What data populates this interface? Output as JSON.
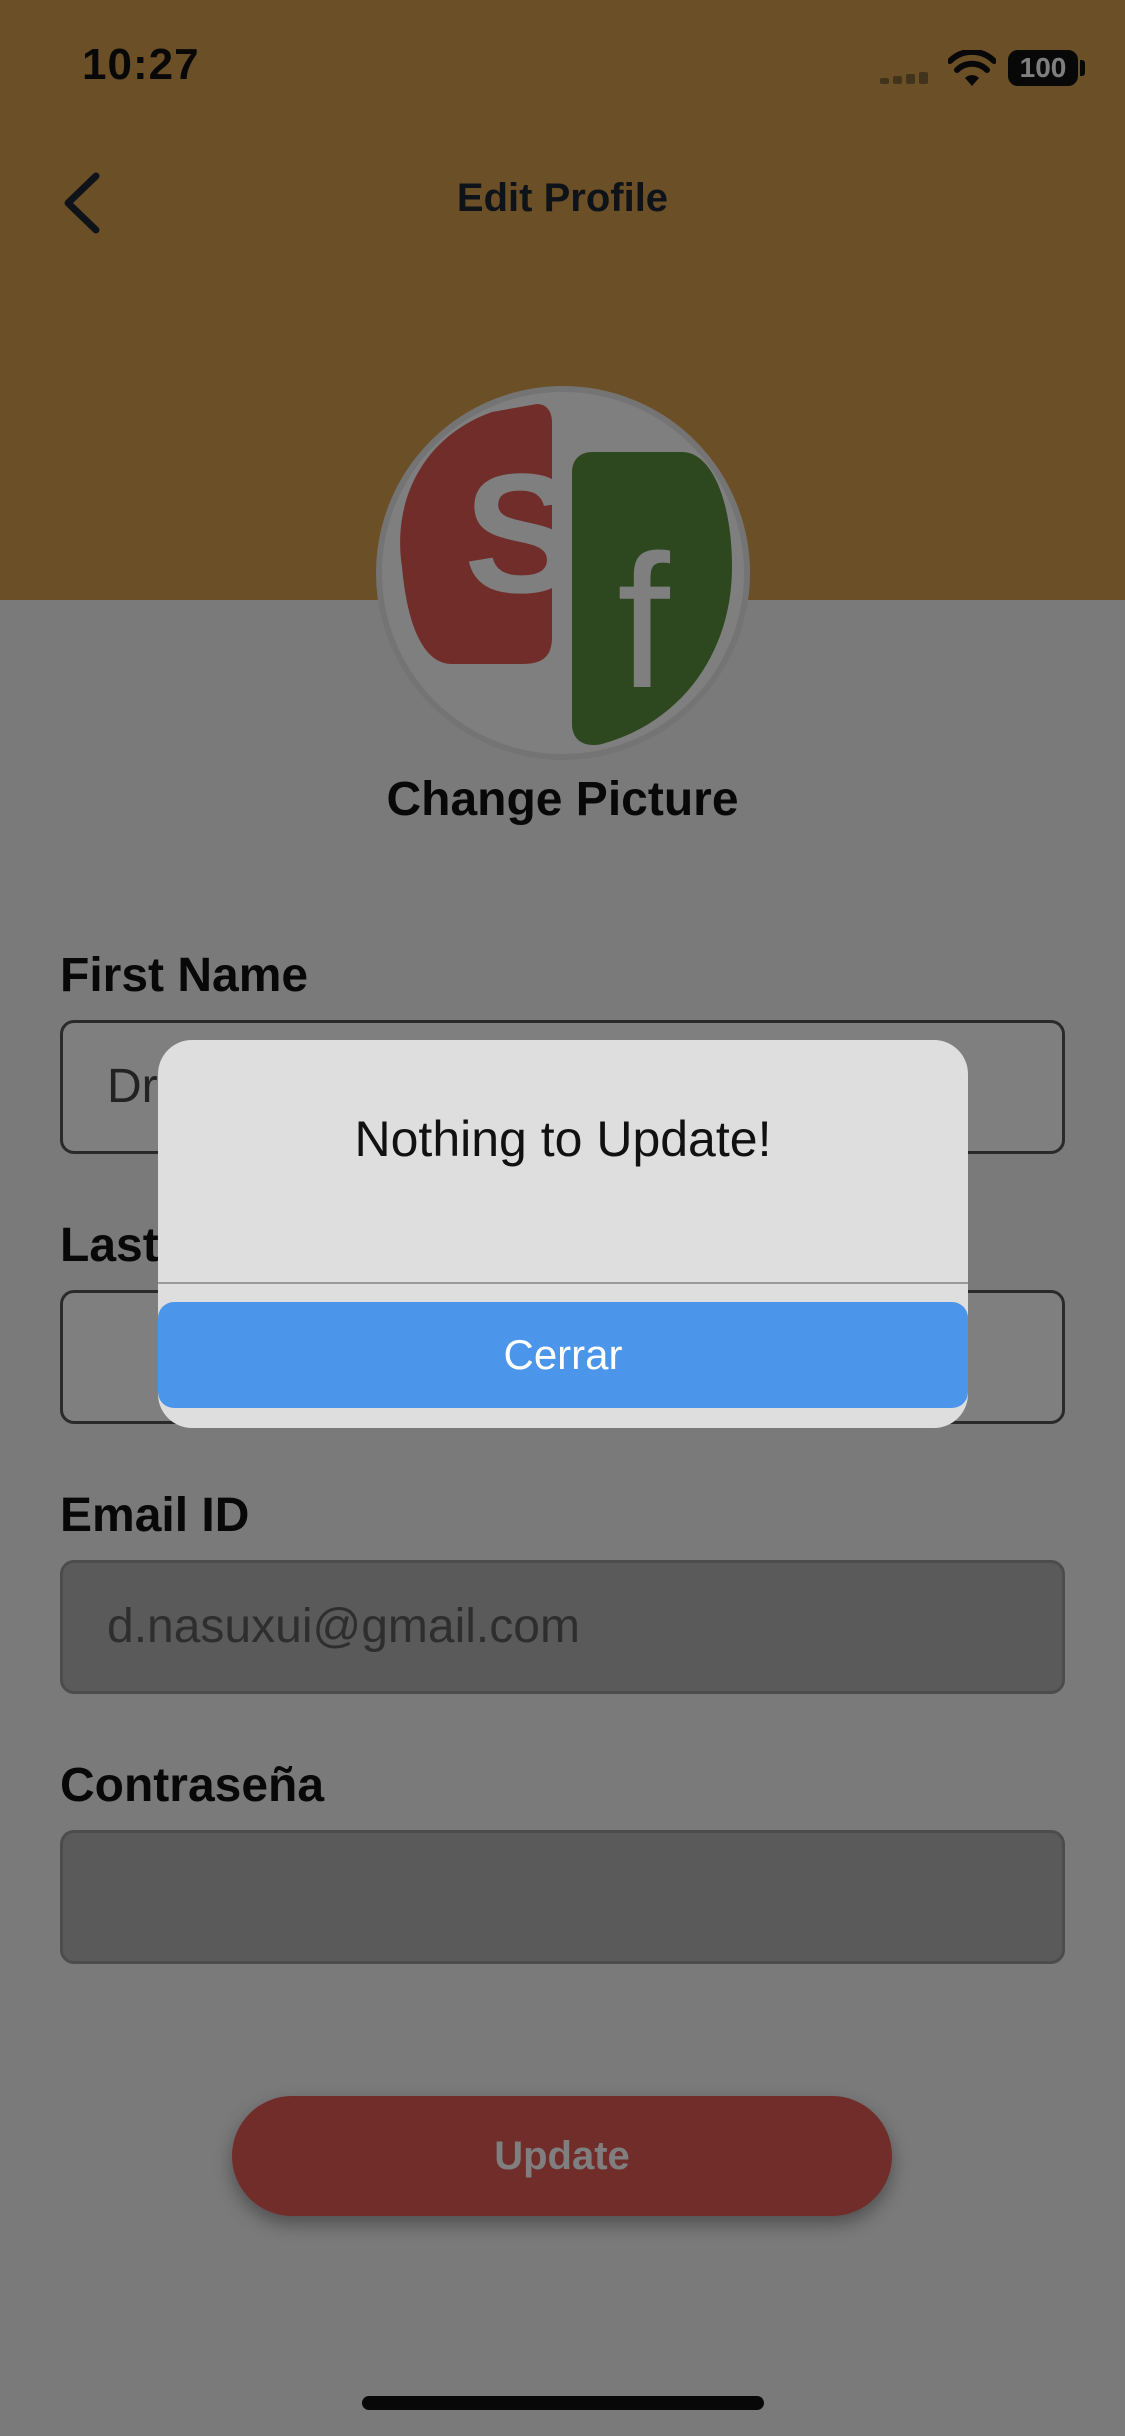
{
  "status_bar": {
    "time": "10:27",
    "battery": "100"
  },
  "header": {
    "title": "Edit Profile"
  },
  "avatar": {
    "logo_letters": [
      "S",
      "f"
    ],
    "change_label": "Change Picture"
  },
  "form": {
    "first_name": {
      "label": "First Name",
      "value": "Dr"
    },
    "last_name": {
      "label": "Last",
      "value": ""
    },
    "email": {
      "label": "Email ID",
      "value": "d.nasuxui@gmail.com"
    },
    "password": {
      "label": "Contraseña",
      "value": ""
    }
  },
  "update_button": {
    "label": "Update"
  },
  "dialog": {
    "message": "Nothing to Update!",
    "button_label": "Cerrar"
  },
  "colors": {
    "header": "#d79f4d",
    "accent_red": "#e05a55",
    "logo_green": "#5a8f3c",
    "dialog_button": "#4b95eb"
  }
}
